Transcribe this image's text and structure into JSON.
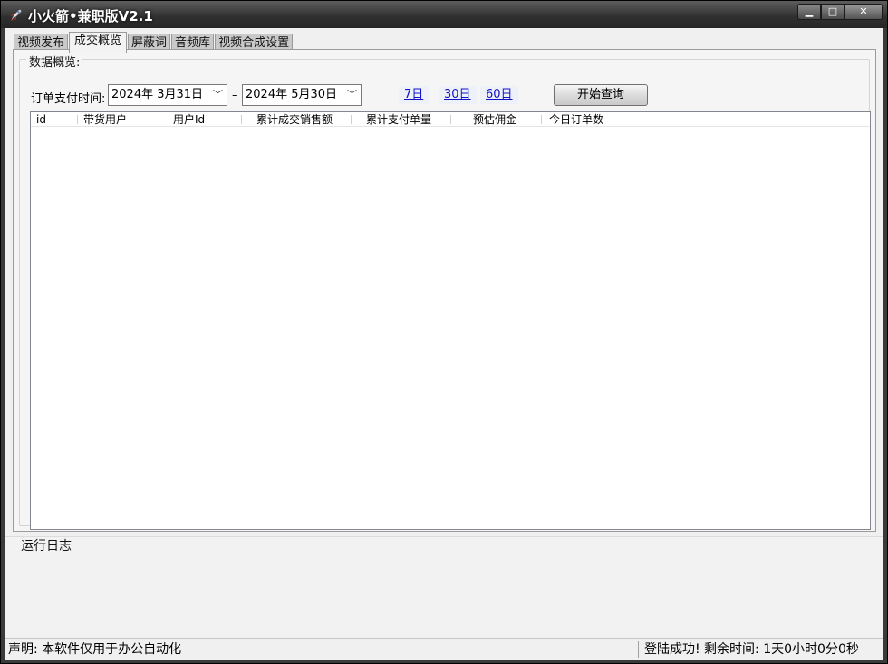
{
  "window": {
    "title": "小火箭•兼职版V2.1",
    "controls": {
      "minimize": "▁",
      "maximize": "□",
      "close": "✕"
    }
  },
  "tabs": [
    {
      "label": "视频发布",
      "active": false
    },
    {
      "label": "成交概览",
      "active": true
    },
    {
      "label": "屏蔽词",
      "active": false
    },
    {
      "label": "音频库",
      "active": false
    },
    {
      "label": "视频合成设置",
      "active": false
    }
  ],
  "overview": {
    "group_title": "数据概览:",
    "date_label": "订单支付时间:",
    "start_date": "2024年  3月31日",
    "end_date": "2024年  5月30日",
    "separator": "–",
    "quick_ranges": [
      "7日",
      "30日",
      "60日"
    ],
    "query_button": "开始查询",
    "columns": [
      "id",
      "带货用户",
      "用户Id",
      "累计成交销售额",
      "累计支付单量",
      "预估佣金",
      "今日订单数"
    ]
  },
  "log": {
    "title": "运行日志"
  },
  "status": {
    "left": "声明: 本软件仅用于办公自动化",
    "right": "登陆成功! 剩余时间: 1天0小时0分0秒"
  },
  "icons": {
    "app_icon": "rocket-icon",
    "dropdown": "chevron-down-icon"
  },
  "colors": {
    "link": "#1212c8",
    "titlebar": "#2f2f2f"
  }
}
